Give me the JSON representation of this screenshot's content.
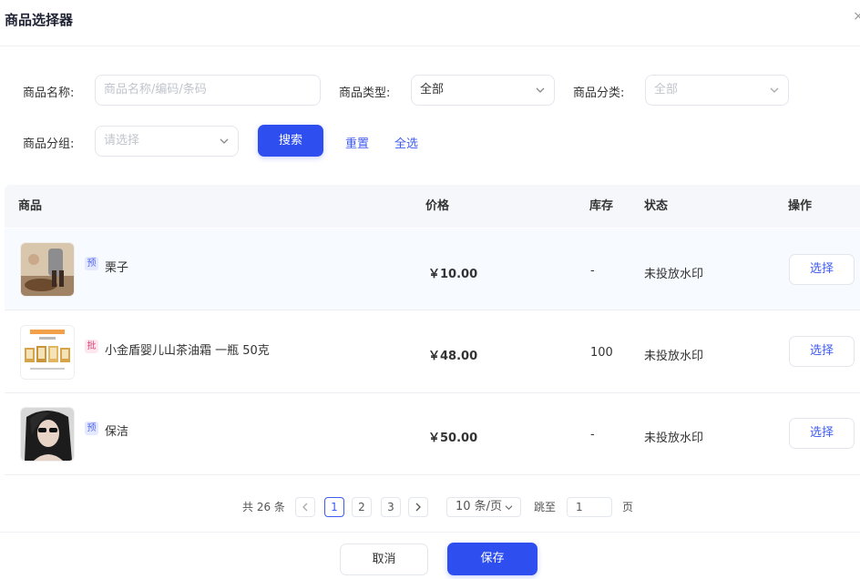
{
  "dialog": {
    "title": "商品选择器"
  },
  "filters": {
    "name_label": "商品名称:",
    "name_placeholder": "商品名称/编码/条码",
    "type_label": "商品类型:",
    "type_value": "全部",
    "category_label": "商品分类:",
    "category_value": "全部",
    "group_label": "商品分组:",
    "group_placeholder": "请选择",
    "search_label": "搜索",
    "reset_label": "重置",
    "select_all_label": "全选"
  },
  "table": {
    "headers": {
      "product": "商品",
      "price": "价格",
      "stock": "库存",
      "status": "状态",
      "action": "操作"
    },
    "rows": [
      {
        "tag": "预",
        "name": "栗子",
        "price": "￥10.00",
        "stock": "-",
        "status": "未投放水印",
        "action": "选择"
      },
      {
        "tag": "批",
        "name": "小金盾婴儿山茶油霜 一瓶 50克",
        "price": "￥48.00",
        "stock": "100",
        "status": "未投放水印",
        "action": "选择"
      },
      {
        "tag": "预",
        "name": "保洁",
        "price": "￥50.00",
        "stock": "-",
        "status": "未投放水印",
        "action": "选择"
      }
    ]
  },
  "pagination": {
    "total": "共 26 条",
    "pages": [
      "1",
      "2",
      "3"
    ],
    "current_page": "1",
    "page_size": "10 条/页",
    "jump_label": "跳至",
    "jump_value": "1",
    "page_unit": "页"
  },
  "footer": {
    "cancel_label": "取消",
    "save_label": "保存"
  },
  "colors": {
    "primary": "#2e4ef0",
    "link": "#3f5bf0"
  }
}
